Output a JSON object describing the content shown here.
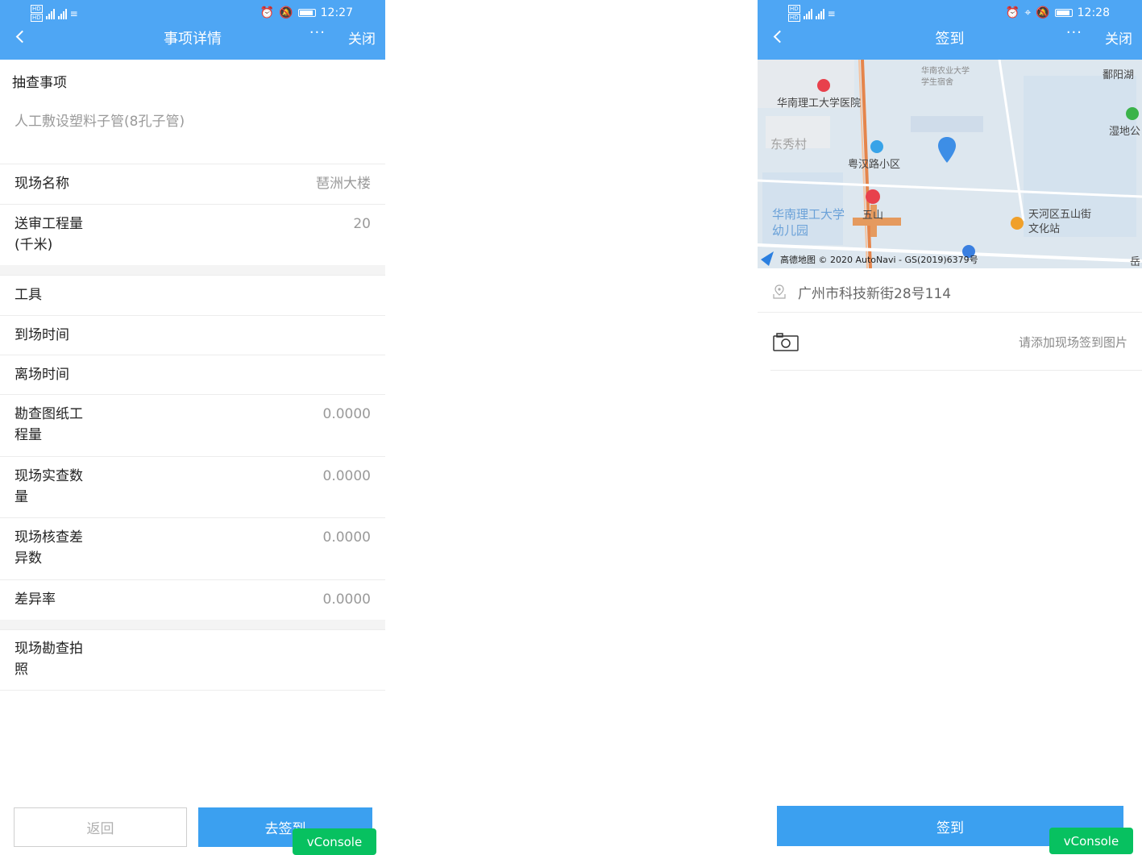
{
  "left": {
    "status": {
      "time": "12:27"
    },
    "nav": {
      "title": "事项详情",
      "more": "···",
      "close": "关闭"
    },
    "section": {
      "title": "抽查事项",
      "value": "人工敷设塑料子管(8孔子管)"
    },
    "rows1": [
      {
        "label": "现场名称",
        "value": "琶洲大楼"
      },
      {
        "label": "送审工程量(千米)",
        "value": "20"
      }
    ],
    "rows2": [
      {
        "label": "工具",
        "value": ""
      },
      {
        "label": "到场时间",
        "value": ""
      },
      {
        "label": "离场时间",
        "value": ""
      },
      {
        "label": "勘查图纸工程量",
        "value": "0.0000"
      },
      {
        "label": "现场实查数量",
        "value": "0.0000"
      },
      {
        "label": "现场核查差异数",
        "value": "0.0000"
      },
      {
        "label": "差异率",
        "value": "0.0000"
      }
    ],
    "rows3": [
      {
        "label": "现场勘查拍照",
        "value": ""
      }
    ],
    "buttons": {
      "back": "返回",
      "go": "去签到"
    },
    "vconsole": "vConsole"
  },
  "right": {
    "status": {
      "time": "12:28"
    },
    "nav": {
      "title": "签到",
      "more": "···",
      "close": "关闭"
    },
    "map": {
      "labels": {
        "hospital": "华南理工大学医院",
        "dorm": "华南农业大学学生宿舍",
        "village": "东秀村",
        "community": "粤汉路小区",
        "kindergarten": "华南理工大学幼儿园",
        "wushan": "五山",
        "culture": "天河区五山街文化站",
        "lake": "鄱阳湖",
        "wetland": "湿地公",
        "edge": "岳"
      },
      "copyright": "高德地图 © 2020 AutoNavi - GS(2019)6379号"
    },
    "address": "广州市科技新街28号114",
    "photo_hint": "请添加现场签到图片",
    "sign_button": "签到",
    "vconsole": "vConsole"
  }
}
